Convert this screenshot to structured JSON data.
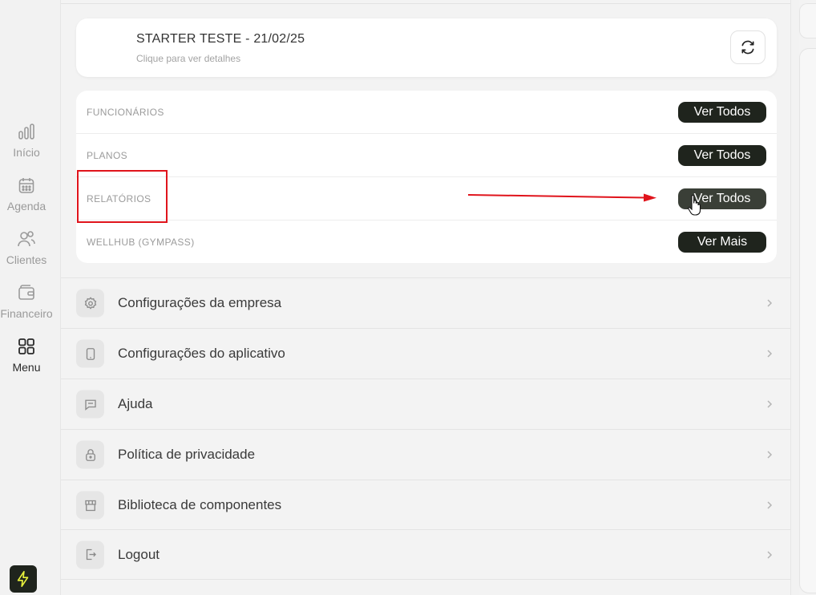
{
  "nav": {
    "items": [
      {
        "label": "Início",
        "icon": "bar-chart-icon"
      },
      {
        "label": "Agenda",
        "icon": "calendar-icon"
      },
      {
        "label": "Clientes",
        "icon": "users-icon"
      },
      {
        "label": "Financeiro",
        "icon": "wallet-icon"
      },
      {
        "label": "Menu",
        "icon": "grid-icon",
        "active": true
      }
    ]
  },
  "company": {
    "title": "STARTER TESTE - 21/02/25",
    "subtitle": "Clique para ver detalhes"
  },
  "sections": [
    {
      "label": "FUNCIONÁRIOS",
      "button": "Ver Todos"
    },
    {
      "label": "PLANOS",
      "button": "Ver Todos"
    },
    {
      "label": "RELATÓRIOS",
      "button": "Ver Todos"
    },
    {
      "label": "WELLHUB (GYMPASS)",
      "button": "Ver Mais"
    }
  ],
  "menu": [
    {
      "label": "Configurações da empresa",
      "icon": "gear-icon"
    },
    {
      "label": "Configurações do aplicativo",
      "icon": "phone-icon"
    },
    {
      "label": "Ajuda",
      "icon": "chat-icon"
    },
    {
      "label": "Política de privacidade",
      "icon": "lock-icon"
    },
    {
      "label": "Biblioteca de componentes",
      "icon": "store-icon"
    },
    {
      "label": "Logout",
      "icon": "logout-icon"
    }
  ],
  "colors": {
    "accent_dark": "#1f241d",
    "annotation_red": "#e0141c",
    "logo_yellow": "#e9f23c"
  }
}
